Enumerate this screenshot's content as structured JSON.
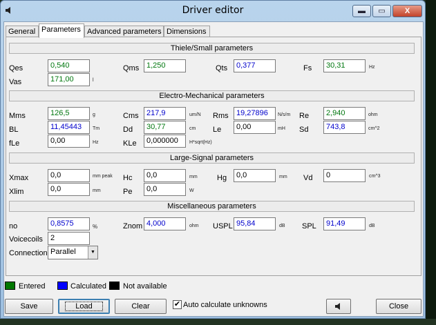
{
  "window": {
    "title": "Driver editor",
    "title_icon": "speaker-icon",
    "min_label": "▬",
    "max_label": "▭",
    "close_label": "X"
  },
  "tabs": [
    {
      "label": "General"
    },
    {
      "label": "Parameters",
      "active": true
    },
    {
      "label": "Advanced parameters"
    },
    {
      "label": "Dimensions"
    }
  ],
  "sections": {
    "thiele_small": "Thiele/Small parameters",
    "electro_mech": "Electro-Mechanical parameters",
    "large_signal": "Large-Signal parameters",
    "misc": "Miscellaneous parameters"
  },
  "params": {
    "qes": {
      "label": "Qes",
      "value": "0,540",
      "unit": ""
    },
    "qms": {
      "label": "Qms",
      "value": "1,250",
      "unit": ""
    },
    "qts": {
      "label": "Qts",
      "value": "0,377",
      "unit": ""
    },
    "fs": {
      "label": "Fs",
      "value": "30,31",
      "unit": "Hz"
    },
    "vas": {
      "label": "Vas",
      "value": "171,00",
      "unit": "l"
    },
    "mms": {
      "label": "Mms",
      "value": "126,5",
      "unit": "g"
    },
    "cms": {
      "label": "Cms",
      "value": "217,9",
      "unit": "um/N"
    },
    "rms": {
      "label": "Rms",
      "value": "19,27896",
      "unit": "N/s/m"
    },
    "re": {
      "label": "Re",
      "value": "2,940",
      "unit": "ohm"
    },
    "bl": {
      "label": "BL",
      "value": "11,45443",
      "unit": "Tm"
    },
    "dd": {
      "label": "Dd",
      "value": "30,77",
      "unit": "cm"
    },
    "le": {
      "label": "Le",
      "value": "0,00",
      "unit": "mH"
    },
    "sd": {
      "label": "Sd",
      "value": "743,8",
      "unit": "cm^2"
    },
    "fle": {
      "label": "fLe",
      "value": "0,00",
      "unit": "Hz"
    },
    "kle": {
      "label": "KLe",
      "value": "0,000000",
      "unit": "H*sqrt(Hz)"
    },
    "xmax": {
      "label": "Xmax",
      "value": "0,0",
      "unit": "mm peak"
    },
    "hc": {
      "label": "Hc",
      "value": "0,0",
      "unit": "mm"
    },
    "hg": {
      "label": "Hg",
      "value": "0,0",
      "unit": "mm"
    },
    "vd": {
      "label": "Vd",
      "value": "0",
      "unit": "cm^3"
    },
    "xlim": {
      "label": "Xlim",
      "value": "0,0",
      "unit": "mm"
    },
    "pe": {
      "label": "Pe",
      "value": "0,0",
      "unit": "W"
    },
    "no": {
      "label": "no",
      "value": "0,8575",
      "unit": "%"
    },
    "znom": {
      "label": "Znom",
      "value": "4,000",
      "unit": "ohm"
    },
    "uspl": {
      "label": "USPL",
      "value": "95,84",
      "unit": "dB"
    },
    "spl": {
      "label": "SPL",
      "value": "91,49",
      "unit": "dB"
    },
    "voicecoils": {
      "label": "Voicecoils",
      "value": "2"
    },
    "connection": {
      "label": "Connection",
      "value": "Parallel"
    }
  },
  "legend": {
    "entered": {
      "label": "Entered",
      "color": "#007700"
    },
    "calculated": {
      "label": "Calculated",
      "color": "#0000ff"
    },
    "na": {
      "label": "Not available",
      "color": "#000000"
    }
  },
  "buttons": {
    "save": "Save",
    "load": "Load",
    "clear": "Clear",
    "auto_calc": "Auto calculate unknowns",
    "auto_calc_checked": "✔",
    "close": "Close",
    "speaker_icon": "speaker-icon"
  }
}
